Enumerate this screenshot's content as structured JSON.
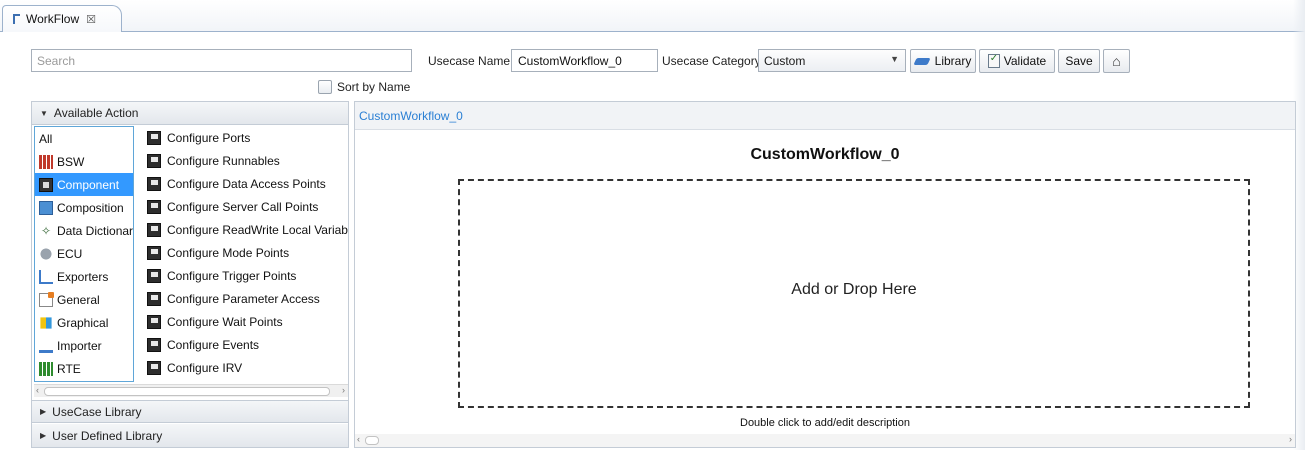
{
  "tab": {
    "label": "WorkFlow",
    "close": "☒"
  },
  "search": {
    "placeholder": "Search"
  },
  "usecase": {
    "name_label": "Usecase Name:",
    "name_value": "CustomWorkflow_0",
    "category_label": "Usecase Category:",
    "category_value": "Custom"
  },
  "toolbar": {
    "library_label": "Library",
    "validate_label": "Validate",
    "save_label": "Save"
  },
  "sort": {
    "label": "Sort by Name",
    "checked": false
  },
  "left": {
    "available_header": "Available Action",
    "categories": [
      {
        "label": "All",
        "icon": "none"
      },
      {
        "label": "BSW",
        "icon": "bsw-icon"
      },
      {
        "label": "Component",
        "icon": "component-icon"
      },
      {
        "label": "Composition",
        "icon": "composition-icon"
      },
      {
        "label": "Data Dictionary",
        "icon": "data-dictionary-icon"
      },
      {
        "label": "ECU",
        "icon": "ecu-icon"
      },
      {
        "label": "Exporters",
        "icon": "exporters-icon"
      },
      {
        "label": "General",
        "icon": "general-icon"
      },
      {
        "label": "Graphical",
        "icon": "graphical-icon"
      },
      {
        "label": "Importer",
        "icon": "importer-icon"
      },
      {
        "label": "RTE",
        "icon": "rte-icon"
      }
    ],
    "selected_category": "Component",
    "actions": [
      "Configure Ports",
      "Configure Runnables",
      "Configure Data Access Points",
      "Configure Server Call Points",
      "Configure ReadWrite Local Variables",
      "Configure Mode Points",
      "Configure Trigger Points",
      "Configure Parameter Access",
      "Configure Wait Points",
      "Configure Events",
      "Configure IRV"
    ],
    "usecase_library_header": "UseCase Library",
    "user_defined_header": "User Defined Library"
  },
  "right": {
    "breadcrumb": "CustomWorkflow_0",
    "title": "CustomWorkflow_0",
    "drop_text": "Add or Drop Here",
    "description": "Double click to add/edit description"
  }
}
